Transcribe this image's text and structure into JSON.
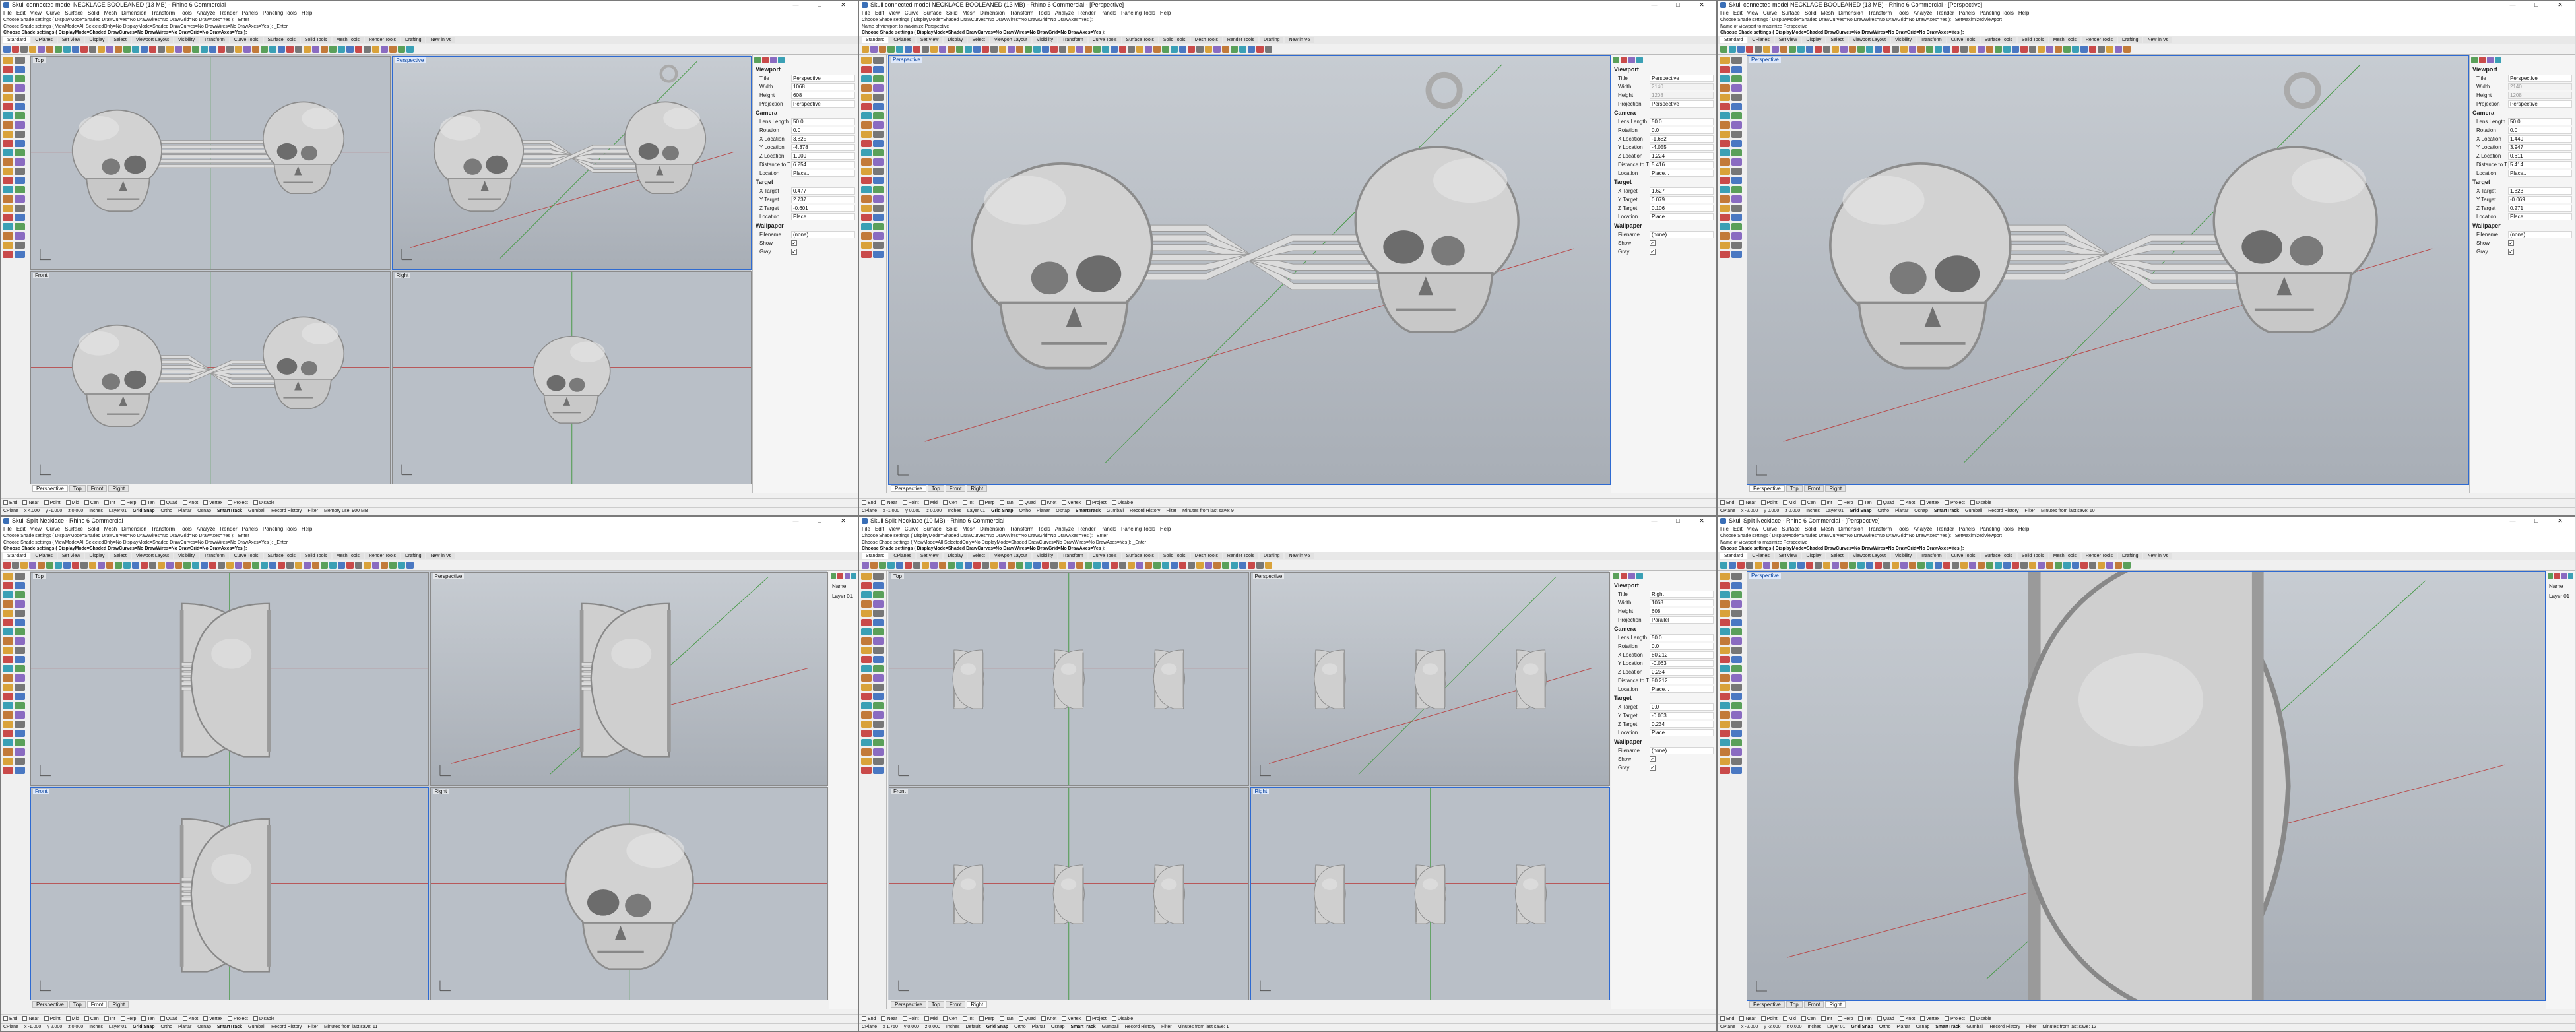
{
  "menu": [
    "File",
    "Edit",
    "View",
    "Curve",
    "Surface",
    "Solid",
    "Mesh",
    "Dimension",
    "Transform",
    "Tools",
    "Analyze",
    "Render",
    "Panels",
    "Paneling Tools",
    "Help"
  ],
  "tabs": [
    "Standard",
    "CPlanes",
    "Set View",
    "Display",
    "Select",
    "Viewport Layout",
    "Visibility",
    "Transform",
    "Curve Tools",
    "Surface Tools",
    "Solid Tools",
    "Mesh Tools",
    "Render Tools",
    "Drafting",
    "New in V6"
  ],
  "vptabs": [
    "Perspective",
    "Top",
    "Front",
    "Right"
  ],
  "osnap_items": [
    "End",
    "Near",
    "Point",
    "Mid",
    "Cen",
    "Int",
    "Perp",
    "Tan",
    "Quad",
    "Knot",
    "Vertex",
    "Project",
    "Disable"
  ],
  "status_common": [
    "Grid Snap",
    "Ortho",
    "Planar",
    "Osnap",
    "SmartTrack",
    "Gumball",
    "Record History",
    "Filter"
  ],
  "panel_labels": {
    "viewport": "Viewport",
    "title": "Title",
    "width": "Width",
    "height": "Height",
    "projection": "Projection",
    "camera": "Camera",
    "lens": "Lens Length",
    "rotation": "Rotation",
    "xloc": "X Location",
    "yloc": "Y Location",
    "zloc": "Z Location",
    "dist": "Distance to T...",
    "location": "Location",
    "place": "Place...",
    "target": "Target",
    "xt": "X Target",
    "yt": "Y Target",
    "zt": "Z Target",
    "wallpaper": "Wallpaper",
    "filename": "Filename",
    "show": "Show",
    "gray": "Gray"
  },
  "windows": [
    {
      "title": "Skull connected model NECKLACE BOOLEANED (13 MB) - Rhino 6 Commercial",
      "cmd": [
        "Choose Shade settings ( DisplayMode=Shaded  DrawCurves=No  DrawWires=No  DrawGrid=No  DrawAxes=Yes ): _Enter",
        "Choose Shade settings ( ViewMode=All  SelectedOnly=No  DisplayMode=Shaded  DrawCurves=No  DrawWires=No  DrawAxes=Yes ): _Enter",
        "Choose Shade settings ( DisplayMode=Shaded  DrawCurves=No  DrawWires=No  DrawGrid=No  DrawAxes=Yes ):"
      ],
      "layout": "quad",
      "views": [
        "Top",
        "Perspective",
        "Front",
        "Right"
      ],
      "active": 1,
      "panel": "props",
      "props": {
        "title": "Perspective",
        "width": "1068",
        "height": "608",
        "projection": "Perspective",
        "lens": "50.0",
        "rotation": "0.0",
        "xloc": "3.825",
        "yloc": "-4.378",
        "zloc": "1.909",
        "dist": "6.254",
        "xt": "0.477",
        "yt": "2.737",
        "zt": "-0.601",
        "filename": "(none)"
      },
      "activeTab": "Perspective",
      "status": {
        "cplane": "CPlane",
        "x": "x 4.000",
        "y": "y -1.000",
        "z": "z 0.000",
        "unit": "Inches",
        "layer": "Layer 01",
        "extra": "Memory use: 900 MB"
      }
    },
    {
      "title": "Skull connected model NECKLACE BOOLEANED (13 MB) - Rhino 6 Commercial - [Perspective]",
      "cmd": [
        "Choose Shade settings ( DisplayMode=Shaded  DrawCurves=No  DrawWires=No  DrawGrid=No  DrawAxes=Yes ):",
        "Name of viewport to maximize Perspective",
        "Choose Shade settings ( DisplayMode=Shaded  DrawCurves=No  DrawWires=No  DrawGrid=No  DrawAxes=Yes ):"
      ],
      "layout": "max",
      "views": [
        "Perspective"
      ],
      "active": 0,
      "panel": "props",
      "props": {
        "title": "Perspective",
        "width": "2140",
        "height": "1208",
        "projection": "Perspective",
        "lens": "50.0",
        "rotation": "0.0",
        "xloc": "-1.682",
        "yloc": "-4.055",
        "zloc": "1.224",
        "dist": "5.416",
        "xt": "1.627",
        "yt": "0.079",
        "zt": "0.106",
        "filename": "(none)"
      },
      "activeTab": "Perspective",
      "status": {
        "cplane": "CPlane",
        "x": "x -1.000",
        "y": "y 0.000",
        "z": "z 0.000",
        "unit": "Inches",
        "layer": "Layer 01",
        "extra": "Minutes from last save: 9"
      }
    },
    {
      "title": "Skull connected model NECKLACE BOOLEANED (13 MB) - Rhino 6 Commercial - [Perspective]",
      "cmd": [
        "Choose Shade settings ( DisplayMode=Shaded  DrawCurves=No  DrawWires=No  DrawGrid=No  DrawAxes=Yes ): _SetMaximizedViewport",
        "Name of viewport to maximize Perspective",
        "Choose Shade settings ( DisplayMode=Shaded  DrawCurves=No  DrawWires=No  DrawGrid=No  DrawAxes=Yes ):"
      ],
      "layout": "max",
      "views": [
        "Perspective"
      ],
      "active": 0,
      "panel": "props",
      "props": {
        "title": "Perspective",
        "width": "2140",
        "height": "1208",
        "projection": "Perspective",
        "lens": "50.0",
        "rotation": "0.0",
        "xloc": "1.449",
        "yloc": "3.947",
        "zloc": "0.611",
        "dist": "5.414",
        "xt": "1.823",
        "yt": "-0.069",
        "zt": "0.271",
        "filename": "(none)"
      },
      "activeTab": "Perspective",
      "status": {
        "cplane": "CPlane",
        "x": "x -2.000",
        "y": "y 0.000",
        "z": "z 0.000",
        "unit": "Inches",
        "layer": "Layer 01",
        "extra": "Minutes from last save: 10"
      }
    },
    {
      "title": "Skull Split Necklace - Rhino 6 Commercial",
      "cmd": [
        "Choose Shade settings ( DisplayMode=Shaded  DrawCurves=No  DrawWires=No  DrawGrid=No  DrawAxes=Yes ): _Enter",
        "Choose Shade settings ( ViewMode=All  SelectedOnly=No  DisplayMode=Shaded  DrawCurves=No  DrawWires=No  DrawAxes=Yes ): _Enter",
        "Choose Shade settings ( DisplayMode=Shaded  DrawCurves=No  DrawWires=No  DrawGrid=No  DrawAxes=Yes ):"
      ],
      "layout": "quad",
      "views": [
        "Top",
        "Perspective",
        "Front",
        "Right"
      ],
      "active": 2,
      "panel": "layers",
      "layers": {
        "name": "Name",
        "material": "Material",
        "linetype": "Linetype",
        "row": "Layer 01"
      },
      "activeTab": "Front",
      "status": {
        "cplane": "CPlane",
        "x": "x -1.000",
        "y": "y 2.000",
        "z": "z 0.000",
        "unit": "Inches",
        "layer": "Layer 01",
        "extra": "Minutes from last save: 11"
      }
    },
    {
      "title": "Skull Split Necklace (10 MB) - Rhino 6 Commercial",
      "cmd": [
        "Choose Shade settings ( DisplayMode=Shaded  DrawCurves=No  DrawWires=No  DrawGrid=No  DrawAxes=Yes ): _Enter",
        "Choose Shade settings ( ViewMode=All  SelectedOnly=No  DisplayMode=Shaded  DrawCurves=No  DrawWires=No  DrawAxes=Yes ): _Enter",
        "Choose Shade settings ( DisplayMode=Shaded  DrawCurves=No  DrawWires=No  DrawGrid=No  DrawAxes=Yes ):"
      ],
      "layout": "quad",
      "views": [
        "Top",
        "Perspective",
        "Front",
        "Right"
      ],
      "active": 3,
      "panel": "props",
      "props": {
        "title": "Right",
        "width": "1068",
        "height": "608",
        "projection": "Parallel",
        "lens": "50.0",
        "rotation": "0.0",
        "xloc": "80.212",
        "yloc": "-0.063",
        "zloc": "0.234",
        "dist": "80.212",
        "xt": "0.0",
        "yt": "-0.063",
        "zt": "0.234",
        "filename": "(none)"
      },
      "activeTab": "Right",
      "status": {
        "cplane": "CPlane",
        "x": "x 1.750",
        "y": "y 0.000",
        "z": "z 0.000",
        "unit": "Inches",
        "layer": "Default",
        "extra": "Minutes from last save: 1"
      }
    },
    {
      "title": "Skull Split Necklace - Rhino 6 Commercial - [Perspective]",
      "cmd": [
        "Choose Shade settings ( DisplayMode=Shaded  DrawCurves=No  DrawWires=No  DrawGrid=No  DrawAxes=Yes ): _SetMaximizedViewport",
        "Name of viewport to maximize Perspective",
        "Choose Shade settings ( DisplayMode=Shaded  DrawCurves=No  DrawWires=No  DrawGrid=No  DrawAxes=Yes ):"
      ],
      "layout": "max",
      "views": [
        "Perspective"
      ],
      "active": 0,
      "panel": "layers",
      "layers": {
        "name": "Name",
        "material": "Material",
        "linetype": "Linetype",
        "row": "Layer 01"
      },
      "activeTab": "Right",
      "status": {
        "cplane": "CPlane",
        "x": "x -2.000",
        "y": "y -2.000",
        "z": "z 0.000",
        "unit": "Inches",
        "layer": "Layer 01",
        "extra": "Minutes from last save: 12"
      }
    }
  ]
}
